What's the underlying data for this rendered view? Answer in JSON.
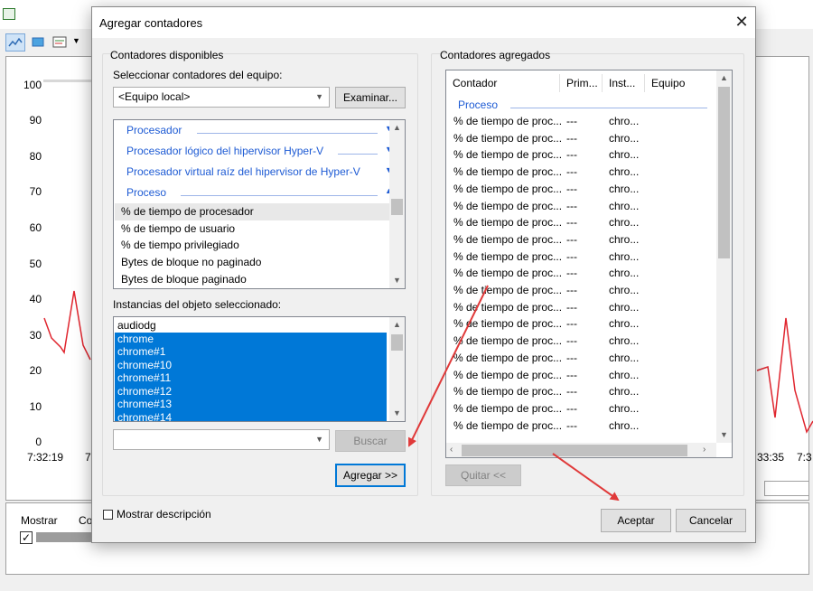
{
  "background": {
    "y_axis_labels": [
      "100",
      "90",
      "80",
      "70",
      "60",
      "50",
      "40",
      "30",
      "20",
      "10",
      "0"
    ],
    "x_axis_labels": [
      "7:32:19",
      "7",
      "33:35",
      "7:3"
    ],
    "bottom_table": {
      "columns": [
        "Mostrar",
        "Co"
      ]
    }
  },
  "dialog": {
    "title": "Agregar contadores",
    "available": {
      "group_title": "Contadores disponibles",
      "select_label": "Seleccionar contadores del equipo:",
      "computer_value": "<Equipo local>",
      "browse_button": "Examinar...",
      "categories": [
        {
          "label": "Procesador",
          "expanded": false
        },
        {
          "label": "Procesador lógico del hipervisor Hyper-V",
          "expanded": false
        },
        {
          "label": "Procesador virtual raíz del hipervisor de Hyper-V",
          "expanded": false
        },
        {
          "label": "Proceso",
          "expanded": true
        }
      ],
      "counters": [
        "% de tiempo de procesador",
        "% de tiempo de usuario",
        "% de tiempo privilegiado",
        "Bytes de bloque no paginado",
        "Bytes de bloque paginado"
      ],
      "instances_label": "Instancias del objeto seleccionado:",
      "instances": [
        {
          "label": "audiodg",
          "selected": false
        },
        {
          "label": "chrome",
          "selected": true
        },
        {
          "label": "chrome#1",
          "selected": true
        },
        {
          "label": "chrome#10",
          "selected": true
        },
        {
          "label": "chrome#11",
          "selected": true
        },
        {
          "label": "chrome#12",
          "selected": true
        },
        {
          "label": "chrome#13",
          "selected": true
        },
        {
          "label": "chrome#14",
          "selected": true
        }
      ],
      "search_value": "",
      "search_button": "Buscar",
      "add_button": "Agregar >>"
    },
    "added": {
      "group_title": "Contadores agregados",
      "columns": [
        "Contador",
        "Prim...",
        "Inst...",
        "Equipo"
      ],
      "group_header": "Proceso",
      "rows": [
        {
          "counter": "% de tiempo de proc...",
          "parent": "---",
          "instance": "chro..."
        },
        {
          "counter": "% de tiempo de proc...",
          "parent": "---",
          "instance": "chro..."
        },
        {
          "counter": "% de tiempo de proc...",
          "parent": "---",
          "instance": "chro..."
        },
        {
          "counter": "% de tiempo de proc...",
          "parent": "---",
          "instance": "chro..."
        },
        {
          "counter": "% de tiempo de proc...",
          "parent": "---",
          "instance": "chro..."
        },
        {
          "counter": "% de tiempo de proc...",
          "parent": "---",
          "instance": "chro..."
        },
        {
          "counter": "% de tiempo de proc...",
          "parent": "---",
          "instance": "chro..."
        },
        {
          "counter": "% de tiempo de proc...",
          "parent": "---",
          "instance": "chro..."
        },
        {
          "counter": "% de tiempo de proc...",
          "parent": "---",
          "instance": "chro..."
        },
        {
          "counter": "% de tiempo de proc...",
          "parent": "---",
          "instance": "chro..."
        },
        {
          "counter": "% de tiempo de proc...",
          "parent": "---",
          "instance": "chro..."
        },
        {
          "counter": "% de tiempo de proc...",
          "parent": "---",
          "instance": "chro..."
        },
        {
          "counter": "% de tiempo de proc...",
          "parent": "---",
          "instance": "chro..."
        },
        {
          "counter": "% de tiempo de proc...",
          "parent": "---",
          "instance": "chro..."
        },
        {
          "counter": "% de tiempo de proc...",
          "parent": "---",
          "instance": "chro..."
        },
        {
          "counter": "% de tiempo de proc...",
          "parent": "---",
          "instance": "chro..."
        },
        {
          "counter": "% de tiempo de proc...",
          "parent": "---",
          "instance": "chro..."
        },
        {
          "counter": "% de tiempo de proc...",
          "parent": "---",
          "instance": "chro..."
        },
        {
          "counter": "% de tiempo de proc...",
          "parent": "---",
          "instance": "chro..."
        }
      ],
      "remove_button": "Quitar <<"
    },
    "show_description_label": "Mostrar descripción",
    "ok_button": "Aceptar",
    "cancel_button": "Cancelar"
  },
  "colors": {
    "selection": "#0078d7",
    "category_text": "#1e5bd4",
    "annotation_arrow": "#e03a3a",
    "chart_line": "#e0262f"
  }
}
